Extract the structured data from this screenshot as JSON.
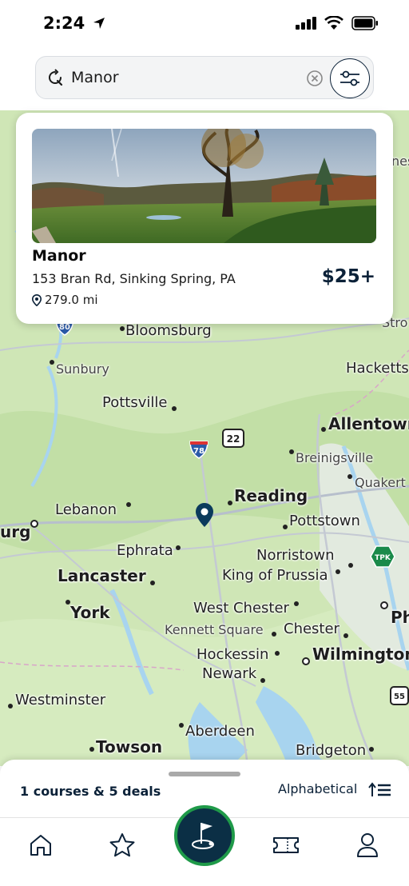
{
  "status_bar": {
    "time": "2:24"
  },
  "search": {
    "value": "Manor"
  },
  "map": {
    "labels": {
      "bloomsburg": "Bloomsburg",
      "sunbury": "Sunbury",
      "pottsville": "Pottsville",
      "allentown": "Allentown",
      "breinigsville": "Breinigsville",
      "quakertown": "Quakert",
      "hackettstown": "Hacketts",
      "stroudsburg": "Stro",
      "reading": "Reading",
      "pottstown": "Pottstown",
      "lebanon": "Lebanon",
      "harrisburg": "urg",
      "ephrata": "Ephrata",
      "norristown": "Norristown",
      "lancaster": "Lancaster",
      "king_of_prussia": "King of Prussia",
      "york": "York",
      "west_chester": "West Chester",
      "kennett_square": "Kennett Square",
      "chester": "Chester",
      "philadelphia": "Ph",
      "hockessin": "Hockessin",
      "wilmington": "Wilmington",
      "newark": "Newark",
      "westminster": "Westminster",
      "aberdeen": "Aberdeen",
      "towson": "Towson",
      "bridgeton": "Bridgeton",
      "top_right_partial": "nes"
    },
    "shields": {
      "i80": "80",
      "i78": "78",
      "us22": "22",
      "tpk": "TPK",
      "r55": "55"
    }
  },
  "course": {
    "name": "Manor",
    "address": "153 Bran Rd, Sinking Spring, PA",
    "distance": "279.0 mi",
    "price": "$25+"
  },
  "results": {
    "count_text": "1 courses & 5 deals",
    "sort_label": "Alphabetical"
  },
  "colors": {
    "brand_navy": "#0b2138",
    "brand_green": "#1f9a49",
    "map_land": "#cfe6b6",
    "map_water": "#a8d4ef"
  }
}
